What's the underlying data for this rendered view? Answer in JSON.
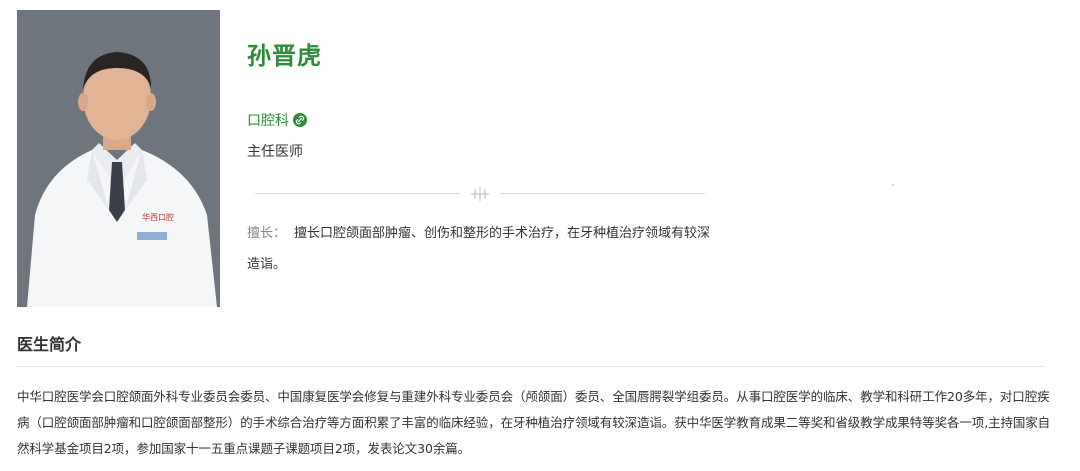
{
  "doctor": {
    "name": "孙晋虎",
    "department": "口腔科",
    "title": "主任医师",
    "specialty_label": "擅长：",
    "specialty_text": "擅长口腔颌面部肿瘤、创伤和整形的手术治疗，在牙种植治疗领域有较深造诣。"
  },
  "bio_section": {
    "heading": "医生简介",
    "text": "中华口腔医学会口腔颌面外科专业委员会委员、中国康复医学会修复与重建外科专业委员会（颅颌面）委员、全国唇腭裂学组委员。从事口腔医学的临床、教学和科研工作20多年，对口腔疾病（口腔颌面部肿瘤和口腔颌面部整形）的手术综合治疗等方面积累了丰富的临床经验，在牙种植治疗领域有较深造诣。获中华医学教育成果二等奖和省级教学成果特等奖各一项,主持国家自然科学基金项目2项，参加国家十一五重点课题子课题项目2项，发表论文30余篇。"
  },
  "colors": {
    "accent": "#2e8b3a",
    "text": "#333333",
    "muted": "#888888"
  },
  "icons": {
    "department_link": "link-icon",
    "divider_ornament": "ornament-icon"
  }
}
